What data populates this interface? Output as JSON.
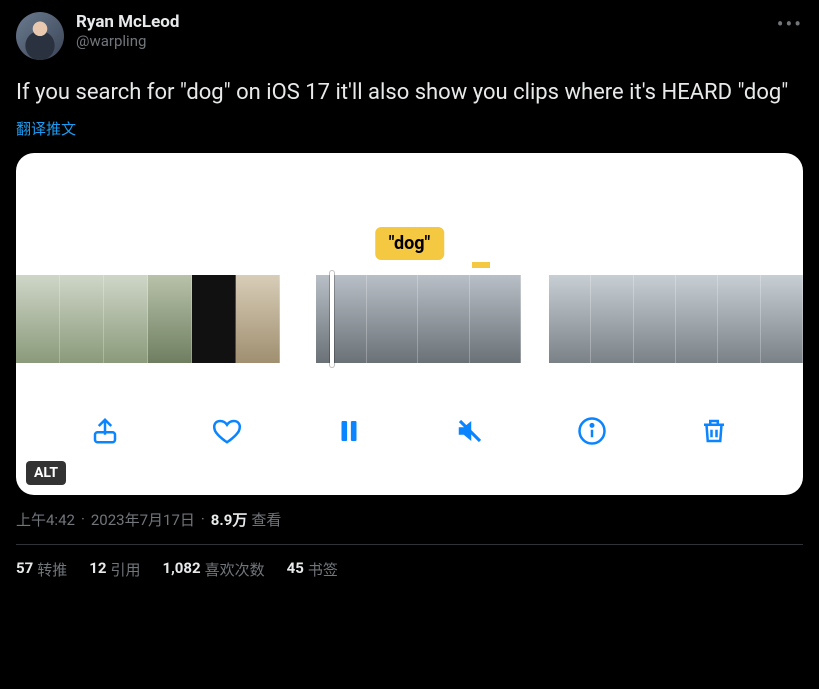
{
  "author": {
    "display_name": "Ryan McLeod",
    "handle": "@warpling"
  },
  "tweet_text": "If you search for \"dog\" on iOS 17 it'll also show you clips where it's HEARD \"dog\"",
  "translate_label": "翻译推文",
  "media": {
    "search_term": "\"dog\"",
    "alt_badge": "ALT",
    "toolbar": {
      "share": "share",
      "like": "like",
      "pause": "pause",
      "mute": "mute",
      "info": "info",
      "delete": "delete"
    }
  },
  "meta": {
    "time": "上午4:42",
    "date": "2023年7月17日",
    "views_number": "8.9万",
    "views_label": "查看"
  },
  "stats": {
    "retweets_num": "57",
    "retweets_label": "转推",
    "quotes_num": "12",
    "quotes_label": "引用",
    "likes_num": "1,082",
    "likes_label": "喜欢次数",
    "bookmarks_num": "45",
    "bookmarks_label": "书签"
  }
}
